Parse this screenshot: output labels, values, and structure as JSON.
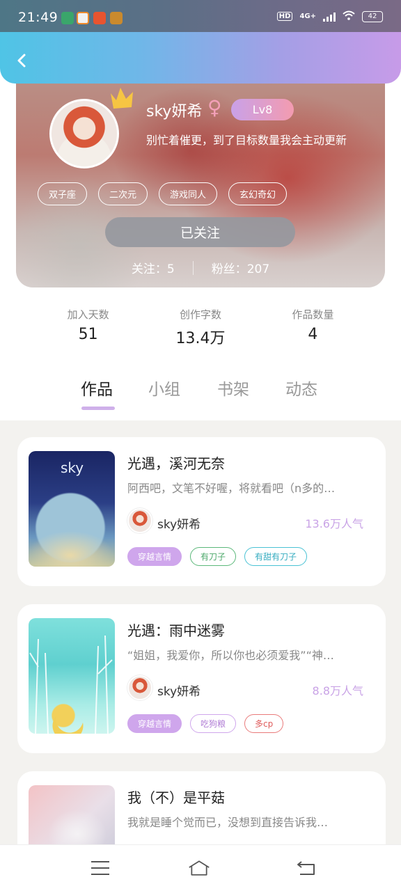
{
  "status_bar": {
    "time": "21:49",
    "hd": "HD",
    "network": "4G+",
    "battery": "42"
  },
  "profile": {
    "username": "sky妍希",
    "gender_symbol": "♀",
    "level": "Lv8",
    "bio": "别忙着催更，到了目标数量我会主动更新",
    "tags": [
      "双子座",
      "二次元",
      "游戏同人",
      "玄幻奇幻"
    ],
    "follow_button": "已关注",
    "following_label": "关注：",
    "following_count": "5",
    "fans_label": "粉丝：",
    "fans_count": "207"
  },
  "stats": {
    "days_label": "加入天数",
    "days_value": "51",
    "words_label": "创作字数",
    "words_value": "13.4万",
    "works_label": "作品数量",
    "works_value": "4"
  },
  "tabs": [
    "作品",
    "小组",
    "书架",
    "动态"
  ],
  "works": [
    {
      "title": "光遇，溪河无奈",
      "desc": "阿西吧，文笔不好喔，将就看吧（n多的…",
      "author": "sky妍希",
      "popularity": "13.6万人气",
      "cover_text": "sky",
      "tags": [
        "穿越言情",
        "有刀子",
        "有甜有刀子"
      ]
    },
    {
      "title": "光遇：雨中迷雾",
      "desc": "“姐姐，我爱你，所以你也必须爱我”“神…",
      "author": "sky妍希",
      "popularity": "8.8万人气",
      "tags": [
        "穿越言情",
        "吃狗粮",
        "多cp"
      ]
    },
    {
      "title": "我（不）是平菇",
      "desc": "我就是睡个觉而已，没想到直接告诉我…"
    }
  ],
  "colors": {
    "accent": "#cfa6ec",
    "popularity": "#c9a3e6",
    "follow_button": "#96989e"
  }
}
